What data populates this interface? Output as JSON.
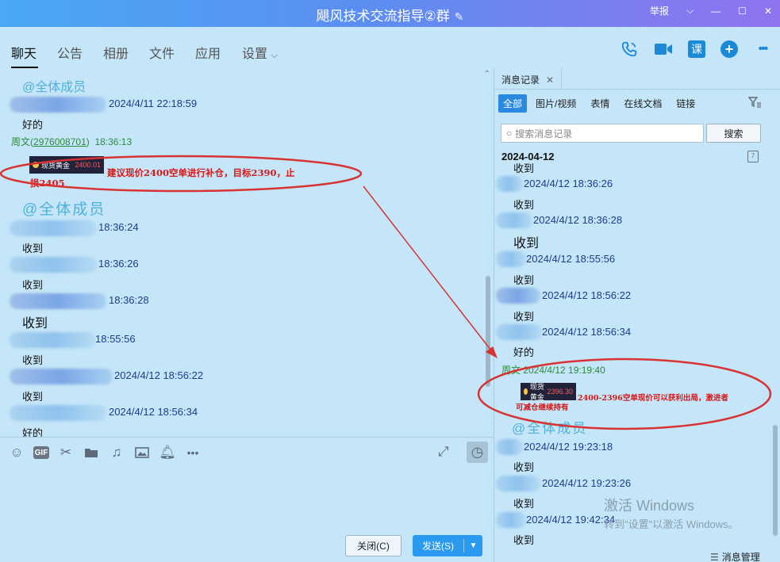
{
  "window": {
    "title": "飓风技术交流指导②群",
    "edit_icon": "edit-icon",
    "report_label": "举报",
    "controls": [
      "chevron-down-icon",
      "minimize-icon",
      "maximize-icon",
      "close-icon"
    ]
  },
  "tabs": {
    "chat": "聊天",
    "notice": "公告",
    "album": "相册",
    "files": "文件",
    "apps": "应用",
    "settings": "设置"
  },
  "header_icons": {
    "call": "phone-icon",
    "video": "video-icon",
    "class_label": "课",
    "add": "+",
    "more": "•••"
  },
  "chat": {
    "mention1": "@全体成员",
    "t1": "2024/4/11 22:18:59",
    "m1": "好的",
    "sender_name": "周文",
    "sender_id": "2976008701",
    "sender_time": "18:36:13",
    "card_label": "现货黄金",
    "card_price": "2400.01",
    "red_note_line1": "建议现价2400空单进行补仓，目标2390，止",
    "red_note_line2": "损2405",
    "mention2": "@全体成员",
    "t2": "18:36:24",
    "m2": "收到",
    "t3": "18:36:26",
    "m3": "收到",
    "t4": "18:36:28",
    "m4": "收到",
    "t5": "18:55:56",
    "m5": "收到",
    "t6": "2024/4/12 18:56:22",
    "m6": "收到",
    "t7": "2024/4/12 18:56:34",
    "m7": "好的"
  },
  "toolbar": {
    "icons": [
      "emoji-icon",
      "gif-icon",
      "scissors-icon",
      "folder-icon",
      "music-icon",
      "image-icon",
      "bell-icon",
      "more-icon"
    ],
    "gif_label": "GIF",
    "expand_icon": "expand-icon",
    "history_icon": "clock-icon"
  },
  "actions": {
    "close_label": "关闭(C)",
    "send_label": "发送(S)"
  },
  "history": {
    "tab_label": "消息记录",
    "filters": [
      "全部",
      "图片/视频",
      "表情",
      "在线文档",
      "链接"
    ],
    "search_placeholder": "搜索消息记录",
    "search_button": "搜索",
    "date": "2024-04-12",
    "cut_label": "收到",
    "h_t1": "2024/4/12 18:36:26",
    "h_m1": "收到",
    "h_t2": "2024/4/12 18:36:28",
    "h_m2": "收到",
    "h_t3": "2024/4/12 18:55:56",
    "h_m3": "收到",
    "h_t4": "2024/4/12 18:56:22",
    "h_m4": "收到",
    "h_t5": "2024/4/12 18:56:34",
    "h_m5": "好的",
    "h_sender": "周文 2024/4/12 19:19:40",
    "h_card_label": "现货黄金",
    "h_card_price": "2396.30",
    "h_red_note_line1": "2400-2396空单现价可以获利出局，激进者",
    "h_red_note_line2": "可减仓继续持有",
    "h_mention": "@全体成员",
    "h_t6": "2024/4/12 19:23:18",
    "h_m6": "收到",
    "h_t7": "2024/4/12 19:23:26",
    "h_m7": "收到",
    "h_t8": "2024/4/12 19:42:34",
    "h_m8": "收到",
    "watermark1": "激活 Windows",
    "watermark2": "转到\"设置\"以激活 Windows。",
    "footer_label": "消息管理"
  },
  "colors": {
    "background": "#c5e5f8",
    "accent": "#1989d8",
    "annotation_red": "#d93232",
    "sender_green": "#2a8c3a",
    "mention_blue": "#4fb1da"
  }
}
